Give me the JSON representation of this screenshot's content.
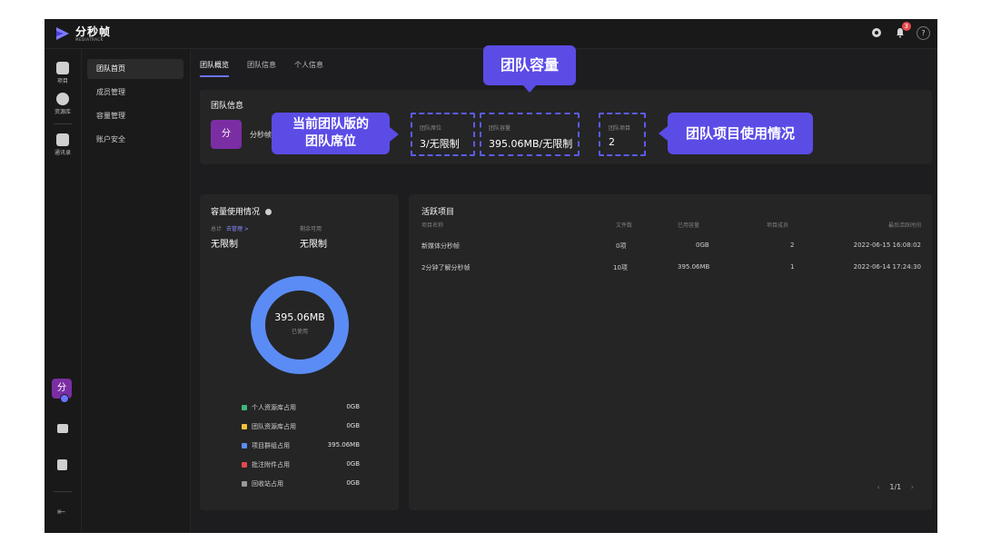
{
  "app": {
    "logo_text": "分秒帧",
    "logo_sub": "MEDIATRACK",
    "notification_count": "3"
  },
  "rail": {
    "items": [
      {
        "label": "项目",
        "icon": "project-icon"
      },
      {
        "label": "资源库",
        "icon": "library-icon"
      },
      {
        "label": "通讯录",
        "icon": "contacts-icon"
      }
    ],
    "avatar_text": "分"
  },
  "subnav": {
    "items": [
      "团队首页",
      "成员管理",
      "容量管理",
      "账户安全"
    ]
  },
  "tabs": [
    "团队概览",
    "团队信息",
    "个人信息"
  ],
  "team_info": {
    "title": "团队信息",
    "avatar_text": "分",
    "name": "分秒帧",
    "seats_label": "团队席位",
    "seats_value": "3/无限制",
    "capacity_label": "团队容量",
    "capacity_value": "395.06MB/无限制",
    "projects_label": "团队项目",
    "projects_value": "2"
  },
  "callouts": {
    "capacity": "团队容量",
    "seats_line1": "当前团队版的",
    "seats_line2": "团队席位",
    "projects": "团队项目使用情况"
  },
  "capacity_usage": {
    "title": "容量使用情况",
    "total_label": "总计",
    "manage_link": "去管理 >",
    "remaining_label": "剩余可用",
    "total_value": "无限制",
    "remaining_value": "无限制",
    "donut_value": "395.06MB",
    "donut_label": "已使用",
    "legend": [
      {
        "label": "个人资源库占用",
        "value": "0GB",
        "color": "#3cb878"
      },
      {
        "label": "团队资源库占用",
        "value": "0GB",
        "color": "#f0c23b"
      },
      {
        "label": "项目群组占用",
        "value": "395.06MB",
        "color": "#5b8cf5"
      },
      {
        "label": "批注附件占用",
        "value": "0GB",
        "color": "#e5484d"
      },
      {
        "label": "回收站占用",
        "value": "0GB",
        "color": "#9a9a9a"
      }
    ]
  },
  "active_projects": {
    "title": "活跃项目",
    "columns": [
      "项目名称",
      "文件数",
      "已用容量",
      "项目成员",
      "最后活跃时间"
    ],
    "rows": [
      [
        "新媒体分秒帧",
        "0项",
        "0GB",
        "2",
        "2022-06-15 16:08:02"
      ],
      [
        "2分钟了解分秒帧",
        "10项",
        "395.06MB",
        "1",
        "2022-06-14 17:24:30"
      ]
    ],
    "pager_text": "1/1"
  },
  "colors": {
    "accent": "#6b73ff",
    "callout": "#5b4ce6",
    "avatar": "#7b2ea4",
    "donut": "#5b8cf5"
  }
}
